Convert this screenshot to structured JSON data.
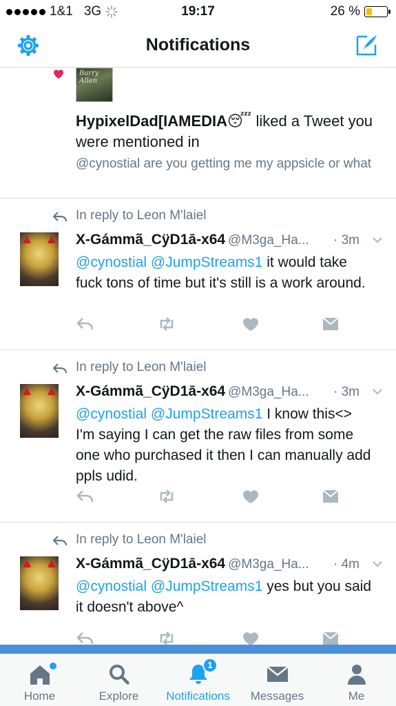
{
  "status": {
    "carrier": "1&1",
    "network": "3G",
    "time": "19:17",
    "battery": "26 %"
  },
  "header": {
    "title": "Notifications"
  },
  "like_notification": {
    "avatar_caption": "Barry Allen",
    "user": "HypixelDad[IAMEDIA",
    "emoji": "😴",
    "action_text": " liked a Tweet you were mentioned in",
    "quoted_text": "@cynostial are you getting me my appsicle or what"
  },
  "tweets": [
    {
      "reply_context": "In reply to Leon M'laiel",
      "name": "X-Gámmã_CÿD1ā-x64",
      "handle": "@M3ga_Ha...",
      "time": "· 3m",
      "mention1": "@cynostial",
      "mention2": "@JumpStreams1",
      "text": " it would take fuck tons of time but it's still is a work around."
    },
    {
      "reply_context": "In reply to Leon M'laiel",
      "name": "X-Gámmã_CÿD1ā-x64",
      "handle": "@M3ga_Ha...",
      "time": "· 3m",
      "mention1": "@cynostial",
      "mention2": "@JumpStreams1",
      "text": " I know this<> I'm saying I can get the raw files from some one who purchased it then I can manually add ppls udid."
    },
    {
      "reply_context": "In reply to Leon M'laiel",
      "name": "X-Gámmã_CÿD1ā-x64",
      "handle": "@M3ga_Ha...",
      "time": "· 4m",
      "mention1": "@cynostial",
      "mention2": "@JumpStreams1",
      "text": " yes but you said it doesn't above^"
    }
  ],
  "tabs": [
    {
      "label": "Home",
      "icon": "home-icon"
    },
    {
      "label": "Explore",
      "icon": "search-icon"
    },
    {
      "label": "Notifications",
      "icon": "bell-icon",
      "badge": "1"
    },
    {
      "label": "Messages",
      "icon": "envelope-icon"
    },
    {
      "label": "Me",
      "icon": "person-icon"
    }
  ],
  "colors": {
    "accent": "#1da1f2",
    "muted": "#657786",
    "heart": "#e0245e"
  }
}
